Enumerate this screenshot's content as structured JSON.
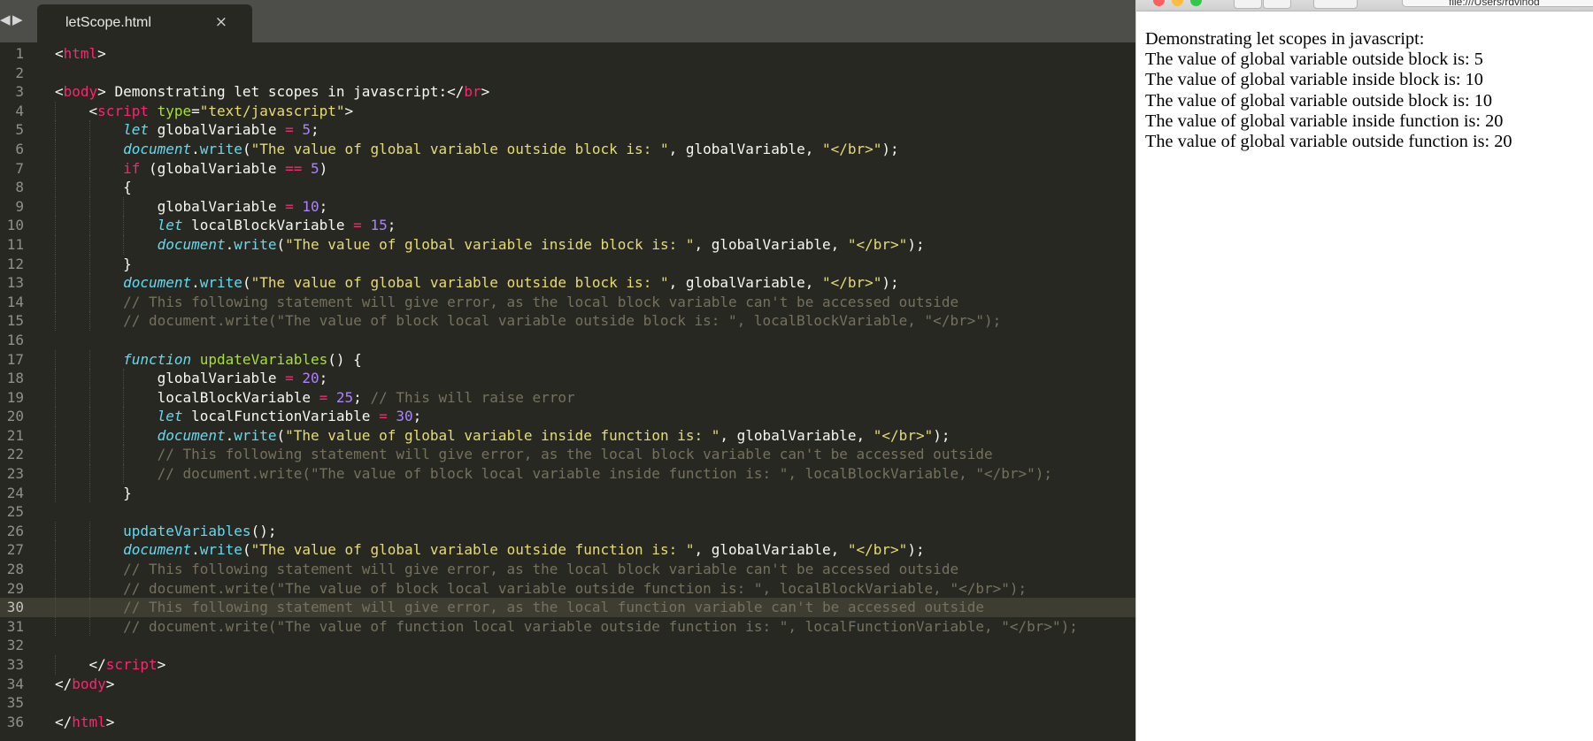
{
  "editor": {
    "tab_title": "letScope.html",
    "tab_close": "×",
    "nav_back": "◀",
    "nav_forward": "▶",
    "current_line": 30,
    "lines": [
      {
        "n": "1",
        "indent": 0,
        "tokens": [
          [
            "tag",
            "<"
          ],
          [
            "tagn",
            "html"
          ],
          [
            "tag",
            ">"
          ]
        ]
      },
      {
        "n": "2",
        "indent": 0,
        "tokens": []
      },
      {
        "n": "3",
        "indent": 0,
        "tokens": [
          [
            "pl",
            "<"
          ],
          [
            "tagn",
            "body"
          ],
          [
            "pl",
            "> Demonstrating let scopes in javascript:</"
          ],
          [
            "tagn",
            "br"
          ],
          [
            "pl",
            ">"
          ]
        ]
      },
      {
        "n": "4",
        "indent": 1,
        "tokens": [
          [
            "pl",
            "<"
          ],
          [
            "tagn",
            "script"
          ],
          [
            "pl",
            " "
          ],
          [
            "attr",
            "type"
          ],
          [
            "pl",
            "="
          ],
          [
            "str",
            "\"text/javascript\""
          ],
          [
            "pl",
            ">"
          ]
        ]
      },
      {
        "n": "5",
        "indent": 2,
        "tokens": [
          [
            "kw",
            "let"
          ],
          [
            "pl",
            " globalVariable "
          ],
          [
            "op",
            "="
          ],
          [
            "pl",
            " "
          ],
          [
            "num",
            "5"
          ],
          [
            "pl",
            ";"
          ]
        ]
      },
      {
        "n": "6",
        "indent": 2,
        "tokens": [
          [
            "obj",
            "document"
          ],
          [
            "pl",
            "."
          ],
          [
            "fn",
            "write"
          ],
          [
            "pl",
            "("
          ],
          [
            "str",
            "\"The value of global variable outside block is: \""
          ],
          [
            "pl",
            ", globalVariable, "
          ],
          [
            "str",
            "\"</br>\""
          ],
          [
            "pl",
            ");"
          ]
        ]
      },
      {
        "n": "7",
        "indent": 2,
        "tokens": [
          [
            "kwp",
            "if"
          ],
          [
            "pl",
            " (globalVariable "
          ],
          [
            "op",
            "=="
          ],
          [
            "pl",
            " "
          ],
          [
            "num",
            "5"
          ],
          [
            "pl",
            ")"
          ]
        ]
      },
      {
        "n": "8",
        "indent": 2,
        "tokens": [
          [
            "pl",
            "{"
          ]
        ]
      },
      {
        "n": "9",
        "indent": 3,
        "tokens": [
          [
            "pl",
            "globalVariable "
          ],
          [
            "op",
            "="
          ],
          [
            "pl",
            " "
          ],
          [
            "num",
            "10"
          ],
          [
            "pl",
            ";"
          ]
        ]
      },
      {
        "n": "10",
        "indent": 3,
        "tokens": [
          [
            "kw",
            "let"
          ],
          [
            "pl",
            " localBlockVariable "
          ],
          [
            "op",
            "="
          ],
          [
            "pl",
            " "
          ],
          [
            "num",
            "15"
          ],
          [
            "pl",
            ";"
          ]
        ]
      },
      {
        "n": "11",
        "indent": 3,
        "tokens": [
          [
            "obj",
            "document"
          ],
          [
            "pl",
            "."
          ],
          [
            "fn",
            "write"
          ],
          [
            "pl",
            "("
          ],
          [
            "str",
            "\"The value of global variable inside block is: \""
          ],
          [
            "pl",
            ", globalVariable, "
          ],
          [
            "str",
            "\"</br>\""
          ],
          [
            "pl",
            ");"
          ]
        ]
      },
      {
        "n": "12",
        "indent": 2,
        "tokens": [
          [
            "pl",
            "}"
          ]
        ]
      },
      {
        "n": "13",
        "indent": 2,
        "tokens": [
          [
            "obj",
            "document"
          ],
          [
            "pl",
            "."
          ],
          [
            "fn",
            "write"
          ],
          [
            "pl",
            "("
          ],
          [
            "str",
            "\"The value of global variable outside block is: \""
          ],
          [
            "pl",
            ", globalVariable, "
          ],
          [
            "str",
            "\"</br>\""
          ],
          [
            "pl",
            ");"
          ]
        ]
      },
      {
        "n": "14",
        "indent": 2,
        "tokens": [
          [
            "cmt",
            "// This following statement will give error, as the local block variable can't be accessed outside"
          ]
        ]
      },
      {
        "n": "15",
        "indent": 2,
        "tokens": [
          [
            "cmt",
            "// document.write(\"The value of block local variable outside block is: \", localBlockVariable, \"</br>\");"
          ]
        ]
      },
      {
        "n": "16",
        "indent": 0,
        "tokens": []
      },
      {
        "n": "17",
        "indent": 2,
        "tokens": [
          [
            "kw",
            "function"
          ],
          [
            "pl",
            " "
          ],
          [
            "fname",
            "updateVariables"
          ],
          [
            "pl",
            "() {"
          ]
        ]
      },
      {
        "n": "18",
        "indent": 3,
        "tokens": [
          [
            "pl",
            "globalVariable "
          ],
          [
            "op",
            "="
          ],
          [
            "pl",
            " "
          ],
          [
            "num",
            "20"
          ],
          [
            "pl",
            ";"
          ]
        ]
      },
      {
        "n": "19",
        "indent": 3,
        "tokens": [
          [
            "pl",
            "localBlockVariable "
          ],
          [
            "op",
            "="
          ],
          [
            "pl",
            " "
          ],
          [
            "num",
            "25"
          ],
          [
            "pl",
            "; "
          ],
          [
            "cmt",
            "// This will raise error"
          ]
        ]
      },
      {
        "n": "20",
        "indent": 3,
        "tokens": [
          [
            "kw",
            "let"
          ],
          [
            "pl",
            " localFunctionVariable "
          ],
          [
            "op",
            "="
          ],
          [
            "pl",
            " "
          ],
          [
            "num",
            "30"
          ],
          [
            "pl",
            ";"
          ]
        ]
      },
      {
        "n": "21",
        "indent": 3,
        "tokens": [
          [
            "obj",
            "document"
          ],
          [
            "pl",
            "."
          ],
          [
            "fn",
            "write"
          ],
          [
            "pl",
            "("
          ],
          [
            "str",
            "\"The value of global variable inside function is: \""
          ],
          [
            "pl",
            ", globalVariable, "
          ],
          [
            "str",
            "\"</br>\""
          ],
          [
            "pl",
            ");"
          ]
        ]
      },
      {
        "n": "22",
        "indent": 3,
        "tokens": [
          [
            "cmt",
            "// This following statement will give error, as the local block variable can't be accessed outside"
          ]
        ]
      },
      {
        "n": "23",
        "indent": 3,
        "tokens": [
          [
            "cmt",
            "// document.write(\"The value of block local variable inside function is: \", localBlockVariable, \"</br>\");"
          ]
        ]
      },
      {
        "n": "24",
        "indent": 2,
        "tokens": [
          [
            "pl",
            "}"
          ]
        ]
      },
      {
        "n": "25",
        "indent": 0,
        "tokens": []
      },
      {
        "n": "26",
        "indent": 2,
        "tokens": [
          [
            "fn",
            "updateVariables"
          ],
          [
            "pl",
            "();"
          ]
        ]
      },
      {
        "n": "27",
        "indent": 2,
        "tokens": [
          [
            "obj",
            "document"
          ],
          [
            "pl",
            "."
          ],
          [
            "fn",
            "write"
          ],
          [
            "pl",
            "("
          ],
          [
            "str",
            "\"The value of global variable outside function is: \""
          ],
          [
            "pl",
            ", globalVariable, "
          ],
          [
            "str",
            "\"</br>\""
          ],
          [
            "pl",
            ");"
          ]
        ]
      },
      {
        "n": "28",
        "indent": 2,
        "tokens": [
          [
            "cmt",
            "// This following statement will give error, as the local block variable can't be accessed outside"
          ]
        ]
      },
      {
        "n": "29",
        "indent": 2,
        "tokens": [
          [
            "cmt",
            "// document.write(\"The value of block local variable outside function is: \", localBlockVariable, \"</br>\");"
          ]
        ]
      },
      {
        "n": "30",
        "indent": 2,
        "tokens": [
          [
            "cmt",
            "// This following statement will give error, as the local function variable can't be accessed outside"
          ]
        ]
      },
      {
        "n": "31",
        "indent": 2,
        "tokens": [
          [
            "cmt",
            "// document.write(\"The value of function local variable outside function is: \", localFunctionVariable, \"</br>\");"
          ]
        ]
      },
      {
        "n": "32",
        "indent": 0,
        "tokens": []
      },
      {
        "n": "33",
        "indent": 1,
        "tokens": [
          [
            "pl",
            "</"
          ],
          [
            "tagn",
            "script"
          ],
          [
            "pl",
            ">"
          ]
        ]
      },
      {
        "n": "34",
        "indent": 0,
        "tokens": [
          [
            "pl",
            "</"
          ],
          [
            "tagn",
            "body"
          ],
          [
            "pl",
            ">"
          ]
        ]
      },
      {
        "n": "35",
        "indent": 0,
        "tokens": []
      },
      {
        "n": "36",
        "indent": 0,
        "tokens": [
          [
            "pl",
            "</"
          ],
          [
            "tagn",
            "html"
          ],
          [
            "pl",
            ">"
          ]
        ]
      }
    ]
  },
  "browser": {
    "url": "file:///Users/rdvinod",
    "colors": {
      "close": "#fc605c",
      "minimize": "#fdbc40",
      "zoom": "#34c84a"
    },
    "output_lines": [
      "Demonstrating let scopes in javascript:",
      "The value of global variable outside block is: 5",
      "The value of global variable inside block is: 10",
      "The value of global variable outside block is: 10",
      "The value of global variable inside function is: 20",
      "The value of global variable outside function is: 20"
    ]
  }
}
